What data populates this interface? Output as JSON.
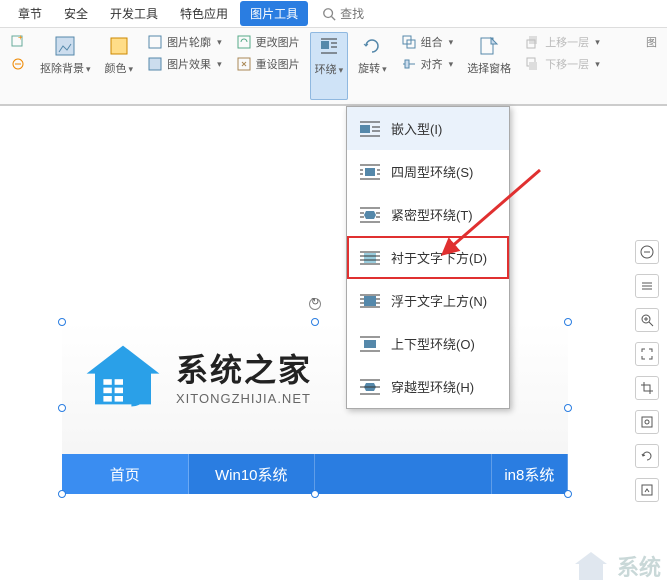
{
  "tabs": {
    "t0": "章节",
    "t1": "安全",
    "t2": "开发工具",
    "t3": "特色应用",
    "t4": "图片工具",
    "t5": "图"
  },
  "search": {
    "placeholder": "查找"
  },
  "ribbon": {
    "cutout": "抠除背景",
    "color": "颜色",
    "outline": "图片轮廓",
    "effect": "图片效果",
    "change": "更改图片",
    "reset": "重设图片",
    "wrap": "环绕",
    "rotate": "旋转",
    "group": "组合",
    "align": "对齐",
    "selpane": "选择窗格",
    "layerup": "上移一层",
    "layerdn": "下移一层"
  },
  "dropdown": {
    "d0": "嵌入型(I)",
    "d1": "四周型环绕(S)",
    "d2": "紧密型环绕(T)",
    "d3": "衬于文字下方(D)",
    "d4": "浮于文字上方(N)",
    "d5": "上下型环绕(O)",
    "d6": "穿越型环绕(H)"
  },
  "image": {
    "logo_cn": "系统之家",
    "logo_en": "XITONGZHIJIA.NET",
    "nav0": "首页",
    "nav1": "Win10系统",
    "nav2": "in8系统"
  },
  "watermark": "系统"
}
